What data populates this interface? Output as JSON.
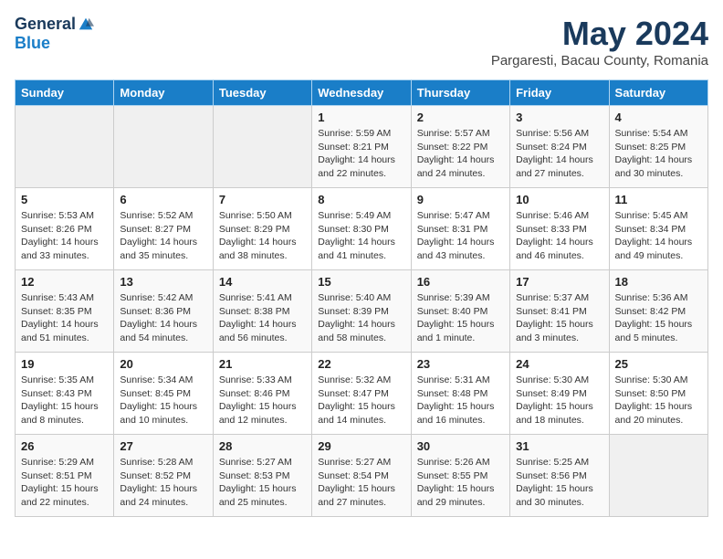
{
  "header": {
    "logo_general": "General",
    "logo_blue": "Blue",
    "month_title": "May 2024",
    "location": "Pargaresti, Bacau County, Romania"
  },
  "days_of_week": [
    "Sunday",
    "Monday",
    "Tuesday",
    "Wednesday",
    "Thursday",
    "Friday",
    "Saturday"
  ],
  "weeks": [
    [
      {
        "day": "",
        "empty": true
      },
      {
        "day": "",
        "empty": true
      },
      {
        "day": "",
        "empty": true
      },
      {
        "day": "1",
        "sunrise": "5:59 AM",
        "sunset": "8:21 PM",
        "daylight": "14 hours and 22 minutes."
      },
      {
        "day": "2",
        "sunrise": "5:57 AM",
        "sunset": "8:22 PM",
        "daylight": "14 hours and 24 minutes."
      },
      {
        "day": "3",
        "sunrise": "5:56 AM",
        "sunset": "8:24 PM",
        "daylight": "14 hours and 27 minutes."
      },
      {
        "day": "4",
        "sunrise": "5:54 AM",
        "sunset": "8:25 PM",
        "daylight": "14 hours and 30 minutes."
      }
    ],
    [
      {
        "day": "5",
        "sunrise": "5:53 AM",
        "sunset": "8:26 PM",
        "daylight": "14 hours and 33 minutes."
      },
      {
        "day": "6",
        "sunrise": "5:52 AM",
        "sunset": "8:27 PM",
        "daylight": "14 hours and 35 minutes."
      },
      {
        "day": "7",
        "sunrise": "5:50 AM",
        "sunset": "8:29 PM",
        "daylight": "14 hours and 38 minutes."
      },
      {
        "day": "8",
        "sunrise": "5:49 AM",
        "sunset": "8:30 PM",
        "daylight": "14 hours and 41 minutes."
      },
      {
        "day": "9",
        "sunrise": "5:47 AM",
        "sunset": "8:31 PM",
        "daylight": "14 hours and 43 minutes."
      },
      {
        "day": "10",
        "sunrise": "5:46 AM",
        "sunset": "8:33 PM",
        "daylight": "14 hours and 46 minutes."
      },
      {
        "day": "11",
        "sunrise": "5:45 AM",
        "sunset": "8:34 PM",
        "daylight": "14 hours and 49 minutes."
      }
    ],
    [
      {
        "day": "12",
        "sunrise": "5:43 AM",
        "sunset": "8:35 PM",
        "daylight": "14 hours and 51 minutes."
      },
      {
        "day": "13",
        "sunrise": "5:42 AM",
        "sunset": "8:36 PM",
        "daylight": "14 hours and 54 minutes."
      },
      {
        "day": "14",
        "sunrise": "5:41 AM",
        "sunset": "8:38 PM",
        "daylight": "14 hours and 56 minutes."
      },
      {
        "day": "15",
        "sunrise": "5:40 AM",
        "sunset": "8:39 PM",
        "daylight": "14 hours and 58 minutes."
      },
      {
        "day": "16",
        "sunrise": "5:39 AM",
        "sunset": "8:40 PM",
        "daylight": "15 hours and 1 minute."
      },
      {
        "day": "17",
        "sunrise": "5:37 AM",
        "sunset": "8:41 PM",
        "daylight": "15 hours and 3 minutes."
      },
      {
        "day": "18",
        "sunrise": "5:36 AM",
        "sunset": "8:42 PM",
        "daylight": "15 hours and 5 minutes."
      }
    ],
    [
      {
        "day": "19",
        "sunrise": "5:35 AM",
        "sunset": "8:43 PM",
        "daylight": "15 hours and 8 minutes."
      },
      {
        "day": "20",
        "sunrise": "5:34 AM",
        "sunset": "8:45 PM",
        "daylight": "15 hours and 10 minutes."
      },
      {
        "day": "21",
        "sunrise": "5:33 AM",
        "sunset": "8:46 PM",
        "daylight": "15 hours and 12 minutes."
      },
      {
        "day": "22",
        "sunrise": "5:32 AM",
        "sunset": "8:47 PM",
        "daylight": "15 hours and 14 minutes."
      },
      {
        "day": "23",
        "sunrise": "5:31 AM",
        "sunset": "8:48 PM",
        "daylight": "15 hours and 16 minutes."
      },
      {
        "day": "24",
        "sunrise": "5:30 AM",
        "sunset": "8:49 PM",
        "daylight": "15 hours and 18 minutes."
      },
      {
        "day": "25",
        "sunrise": "5:30 AM",
        "sunset": "8:50 PM",
        "daylight": "15 hours and 20 minutes."
      }
    ],
    [
      {
        "day": "26",
        "sunrise": "5:29 AM",
        "sunset": "8:51 PM",
        "daylight": "15 hours and 22 minutes."
      },
      {
        "day": "27",
        "sunrise": "5:28 AM",
        "sunset": "8:52 PM",
        "daylight": "15 hours and 24 minutes."
      },
      {
        "day": "28",
        "sunrise": "5:27 AM",
        "sunset": "8:53 PM",
        "daylight": "15 hours and 25 minutes."
      },
      {
        "day": "29",
        "sunrise": "5:27 AM",
        "sunset": "8:54 PM",
        "daylight": "15 hours and 27 minutes."
      },
      {
        "day": "30",
        "sunrise": "5:26 AM",
        "sunset": "8:55 PM",
        "daylight": "15 hours and 29 minutes."
      },
      {
        "day": "31",
        "sunrise": "5:25 AM",
        "sunset": "8:56 PM",
        "daylight": "15 hours and 30 minutes."
      },
      {
        "day": "",
        "empty": true
      }
    ]
  ]
}
